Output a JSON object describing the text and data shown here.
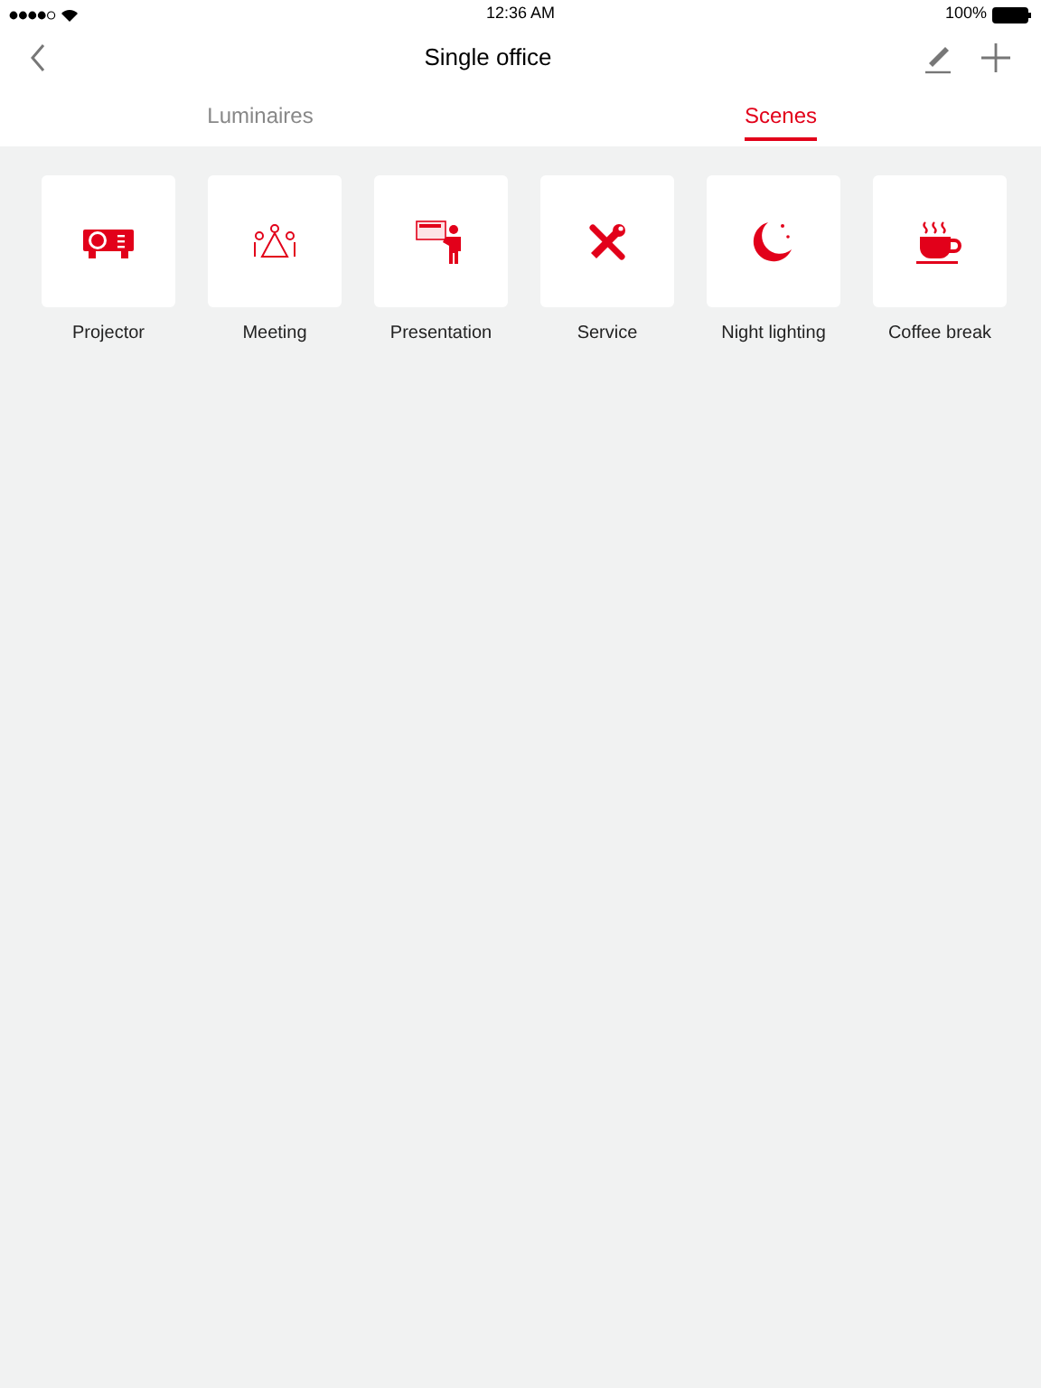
{
  "status_bar": {
    "time": "12:36 AM",
    "battery": "100%"
  },
  "nav": {
    "title": "Single office"
  },
  "tabs": [
    {
      "label": "Luminaires",
      "selected": false
    },
    {
      "label": "Scenes",
      "selected": true
    }
  ],
  "scenes": [
    {
      "label": "Projector",
      "kind": "projector"
    },
    {
      "label": "Meeting",
      "kind": "meeting"
    },
    {
      "label": "Presentation",
      "kind": "presentation"
    },
    {
      "label": "Service",
      "kind": "service"
    },
    {
      "label": "Night lighting",
      "kind": "night"
    },
    {
      "label": "Coffee break",
      "kind": "coffee"
    }
  ]
}
